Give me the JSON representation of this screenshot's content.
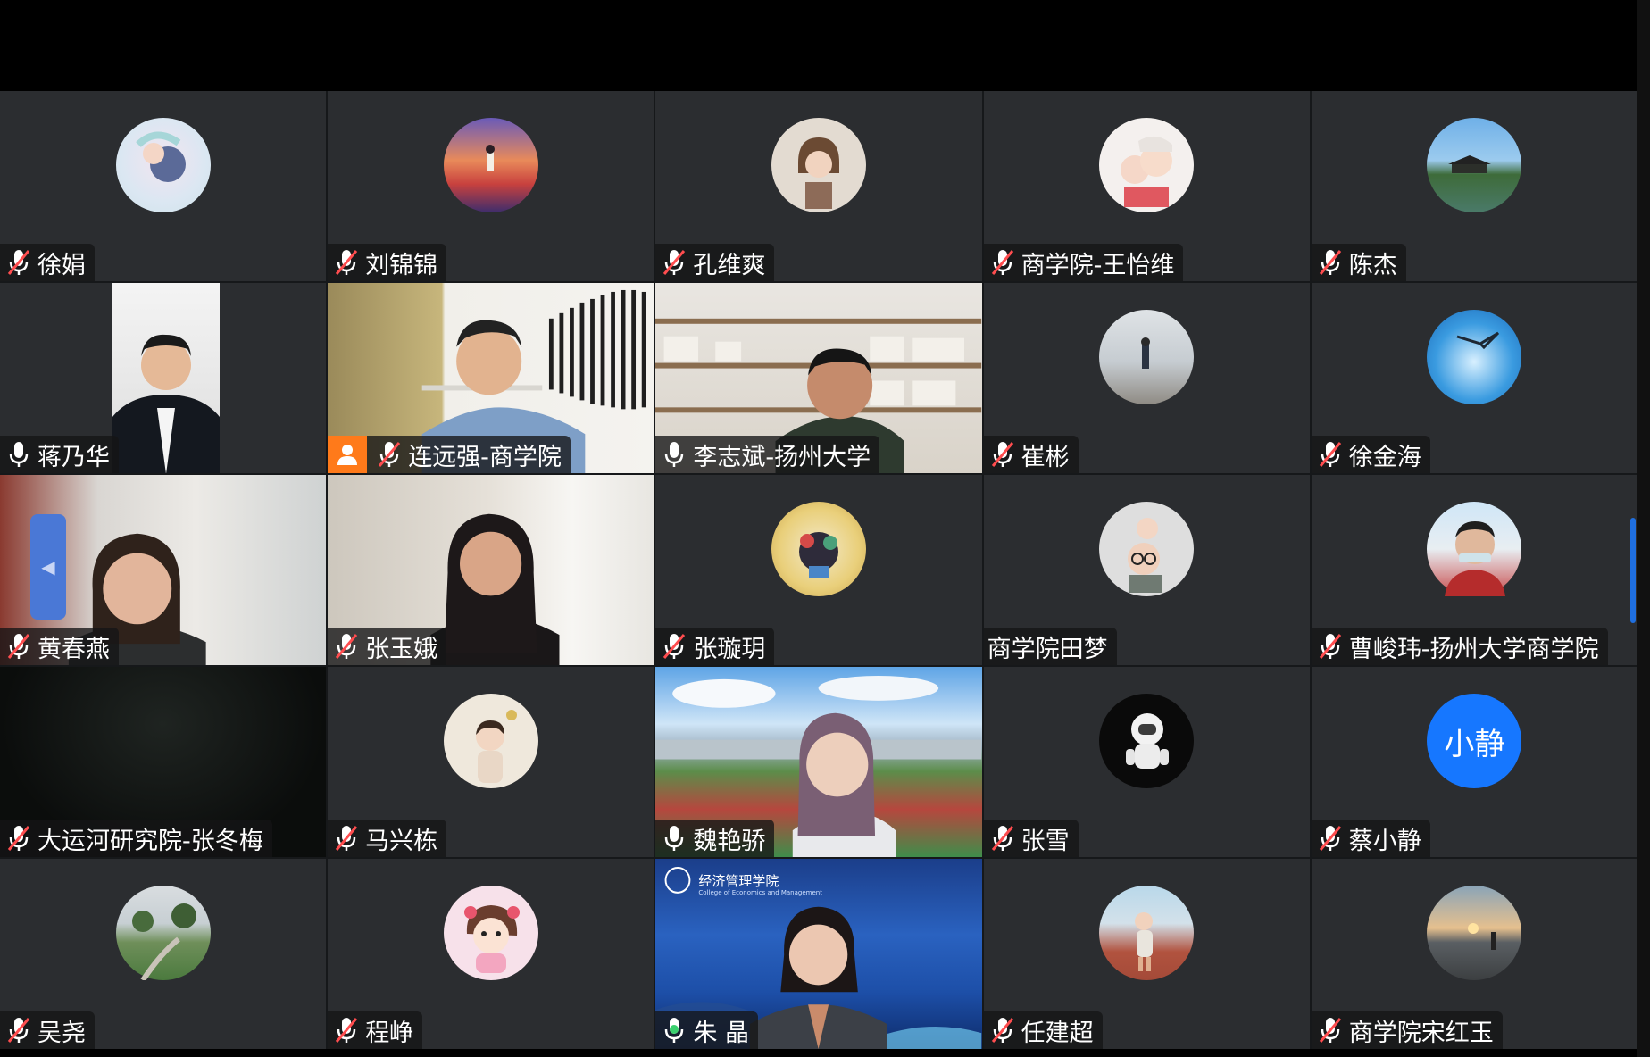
{
  "participants": [
    {
      "name": "徐娟",
      "mic": "muted"
    },
    {
      "name": "刘锦锦",
      "mic": "muted"
    },
    {
      "name": "孔维爽",
      "mic": "muted"
    },
    {
      "name": "商学院-王怡维",
      "mic": "muted"
    },
    {
      "name": "陈杰",
      "mic": "muted"
    },
    {
      "name": "蒋乃华",
      "mic": "on"
    },
    {
      "name": "连远强-商学院",
      "mic": "muted",
      "host": true
    },
    {
      "name": "李志斌-扬州大学",
      "mic": "on"
    },
    {
      "name": "崔彬",
      "mic": "muted"
    },
    {
      "name": "徐金海",
      "mic": "muted"
    },
    {
      "name": "黄春燕",
      "mic": "muted"
    },
    {
      "name": "张玉娥",
      "mic": "muted"
    },
    {
      "name": "张璇玥",
      "mic": "muted"
    },
    {
      "name": "商学院田梦",
      "mic": "none"
    },
    {
      "name": "曹峻玮-扬州大学商学院",
      "mic": "muted"
    },
    {
      "name": "大运河研究院-张冬梅",
      "mic": "muted"
    },
    {
      "name": "马兴栋",
      "mic": "muted"
    },
    {
      "name": "魏艳骄",
      "mic": "on"
    },
    {
      "name": "张雪",
      "mic": "muted"
    },
    {
      "name": "蔡小静",
      "mic": "muted",
      "avatar_text": "小静"
    },
    {
      "name": "吴尧",
      "mic": "muted"
    },
    {
      "name": "程峥",
      "mic": "muted"
    },
    {
      "name": "朱 晶",
      "mic": "speaking"
    },
    {
      "name": "任建超",
      "mic": "muted"
    },
    {
      "name": "商学院宋红玉",
      "mic": "muted"
    }
  ],
  "branding": {
    "college_name": "经济管理学院",
    "college_en": "College of Economics and Management"
  },
  "colors": {
    "tile_bg": "#2b2d30",
    "host_badge": "#ff7a1a",
    "muted_slash": "#ff4d4f",
    "speaking": "#3bd16f",
    "avatar_blue": "#1677ff"
  }
}
